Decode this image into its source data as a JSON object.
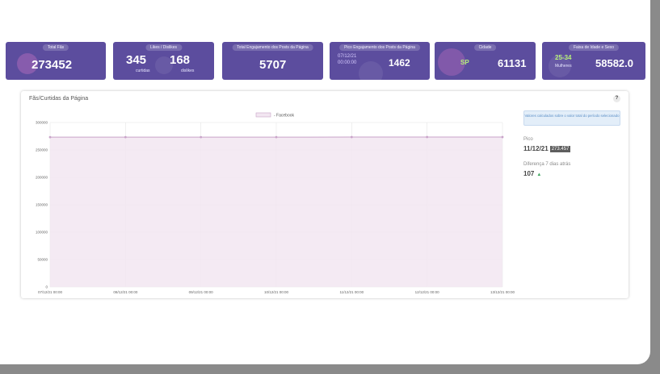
{
  "kpis": [
    {
      "label": "Total Fãs",
      "value": "273452"
    },
    {
      "label": "Likes / Dislikes",
      "likes": "345",
      "likes_sub": "curtidas",
      "dislikes": "168",
      "dislikes_sub": "dislikes"
    },
    {
      "label": "Total Engajamento dos Posts da Página",
      "value": "5707"
    },
    {
      "label": "Pico Engajamento dos Posts da Página",
      "date": "07/12/21",
      "time": "00:00:00",
      "value": "1462"
    },
    {
      "label": "Cidade",
      "city": "SP",
      "value": "61131"
    },
    {
      "label": "Faixa de Idade e Sexo",
      "age": "25-34",
      "sex": "Mulheres",
      "value": "58582.0"
    }
  ],
  "card": {
    "title": "Fãs/Curtidas da Página",
    "help": "?",
    "note": "Valores calculados sobre o valor total do período selecionado",
    "pico_label": "Pico",
    "pico_date": "11/12/21",
    "pico_value": "273.457",
    "diff_label": "Diferença 7 dias atrás",
    "diff_value": "107",
    "diff_arrow": "▲"
  },
  "chart_data": {
    "type": "area",
    "x": [
      "07/12/21 00:00",
      "08/12/21 00:00",
      "09/12/21 00:00",
      "10/12/21 00:00",
      "11/12/21 00:00",
      "12/12/21 00:00",
      "13/12/21 00:00"
    ],
    "series": [
      {
        "name": "- Facebook",
        "values": [
          273345,
          273360,
          273380,
          273400,
          273457,
          273440,
          273452
        ]
      }
    ],
    "yticks": [
      "300000",
      "250000",
      "200000",
      "150000",
      "100000",
      "50000",
      "0"
    ],
    "ylim": [
      0,
      300000
    ],
    "grid": true,
    "legend": "top-center",
    "colors": {
      "line": "#c9a3c9",
      "fill": "#f2e6f1",
      "grid": "#e6e6e6"
    }
  }
}
